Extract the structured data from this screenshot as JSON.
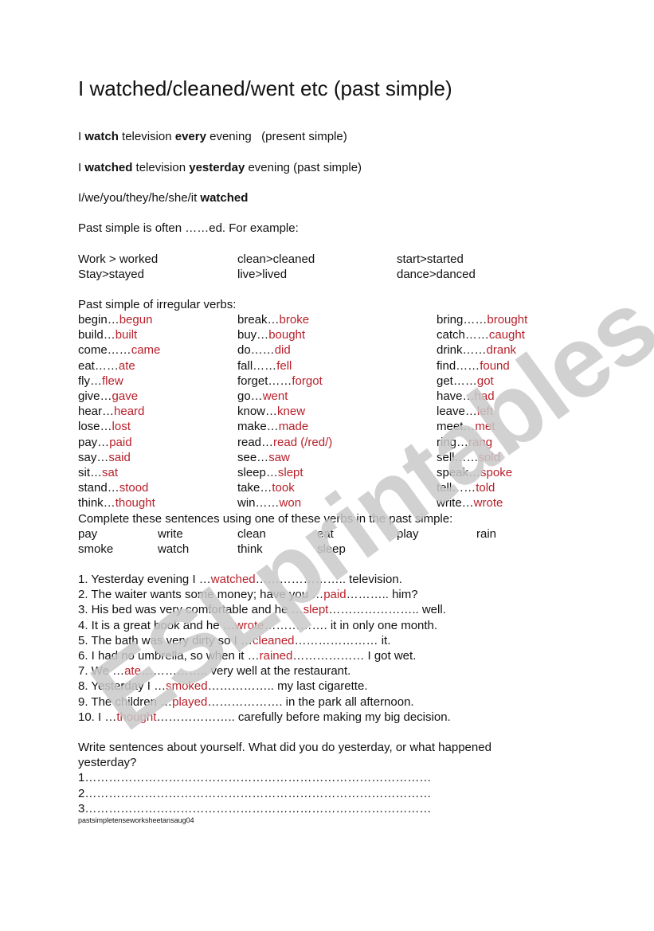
{
  "title": "I watched/cleaned/went etc (past simple)",
  "intro": {
    "line1": {
      "p1": "I ",
      "b1": "watch",
      "p2": " television ",
      "b2": "every",
      "p3": " evening   (present simple)"
    },
    "line2": {
      "p1": "I ",
      "b1": "watched",
      "p2": " television ",
      "b2": "yesterday",
      "p3": " evening (past simple)"
    },
    "line3": {
      "p1": "I/we/you/they/he/she/it ",
      "b1": "watched"
    },
    "line4": "Past simple is often ……ed. For example:"
  },
  "regular_examples": [
    [
      "Work > worked",
      "clean>cleaned",
      "start>started"
    ],
    [
      "Stay>stayed",
      "live>lived",
      "dance>danced"
    ]
  ],
  "irregular_heading": "Past simple of irregular verbs:",
  "irregular_verbs": [
    [
      {
        "base": "begin…",
        "past": "begun"
      },
      {
        "base": "break…",
        "past": "broke"
      },
      {
        "base": "bring……",
        "past": "brought"
      }
    ],
    [
      {
        "base": "build…",
        "past": "built"
      },
      {
        "base": "buy…",
        "past": "bought"
      },
      {
        "base": "catch……",
        "past": "caught"
      }
    ],
    [
      {
        "base": "come……",
        "past": "came"
      },
      {
        "base": "do……",
        "past": "did"
      },
      {
        "base": "drink……",
        "past": "drank"
      }
    ],
    [
      {
        "base": "eat……",
        "past": "ate"
      },
      {
        "base": "fall……",
        "past": "fell"
      },
      {
        "base": "find……",
        "past": "found"
      }
    ],
    [
      {
        "base": "fly…",
        "past": "flew"
      },
      {
        "base": "forget……",
        "past": "forgot"
      },
      {
        "base": "get……",
        "past": "got"
      }
    ],
    [
      {
        "base": "give…",
        "past": "gave"
      },
      {
        "base": "go…",
        "past": "went"
      },
      {
        "base": "have…",
        "past": "had"
      }
    ],
    [
      {
        "base": "hear…",
        "past": "heard"
      },
      {
        "base": "know…",
        "past": "knew"
      },
      {
        "base": "leave…",
        "past": "left"
      }
    ],
    [
      {
        "base": "lose…",
        "past": "lost"
      },
      {
        "base": "make…",
        "past": "made"
      },
      {
        "base": "meet…",
        "past": "met"
      }
    ],
    [
      {
        "base": "pay…",
        "past": "paid"
      },
      {
        "base": "read…",
        "past": "read (/red/)"
      },
      {
        "base": "ring…",
        "past": "rang"
      }
    ],
    [
      {
        "base": "say…",
        "past": "said"
      },
      {
        "base": "see…",
        "past": "saw"
      },
      {
        "base": "sell……",
        "past": "sold"
      }
    ],
    [
      {
        "base": "sit…",
        "past": "sat"
      },
      {
        "base": "sleep…",
        "past": "slept"
      },
      {
        "base": "speak…",
        "past": "spoke"
      }
    ],
    [
      {
        "base": "stand…",
        "past": "stood"
      },
      {
        "base": "take…",
        "past": "took"
      },
      {
        "base": "tell……",
        "past": "told"
      }
    ],
    [
      {
        "base": "think…",
        "past": "thought"
      },
      {
        "base": "win……",
        "past": "won"
      },
      {
        "base": "write…",
        "past": "wrote"
      }
    ]
  ],
  "exercise1": {
    "instruction": "Complete these sentences using one of these verbs in the past simple:",
    "verbs_row1": [
      "pay",
      "write",
      "clean",
      "eat",
      "play",
      "rain"
    ],
    "verbs_row2": [
      "smoke",
      "watch",
      "think",
      "sleep"
    ],
    "sentences": [
      {
        "pre": "1. Yesterday evening I …",
        "answer": "watched",
        "post": "………………….. television."
      },
      {
        "pre": "2. The waiter wants some money; have you …",
        "answer": "paid",
        "post": "………..  him?"
      },
      {
        "pre": "3. His bed was very comfortable and he …",
        "answer": "slept",
        "post": "………………….. well."
      },
      {
        "pre": "4. It is a great book and he …",
        "answer": "wrote",
        "post": "……………. it in only one month."
      },
      {
        "pre": "5. The bath was very dirty so I …",
        "answer": "cleaned",
        "post": "………………… it."
      },
      {
        "pre": "6. I had no umbrella, so when it …",
        "answer": "rained",
        "post": "……………… I got wet."
      },
      {
        "pre": "7. We …",
        "answer": "ate",
        "post": "……………..  very well at the restaurant."
      },
      {
        "pre": "8. Yesterday I …",
        "answer": "smoked",
        "post": "…………….. my last cigarette."
      },
      {
        "pre": "9. The children …",
        "answer": "played",
        "post": "………………. in the park all afternoon."
      },
      {
        "pre": "10. I …",
        "answer": "thought",
        "post": "……………….. carefully before making my big decision."
      }
    ]
  },
  "exercise2": {
    "instruction_line1": "Write sentences about yourself. What did you do yesterday, or what happened",
    "instruction_line2": "yesterday?",
    "lines": [
      "1……………………………………………………………………………",
      "2……………………………………………………………………………",
      "3……………………………………………………………………………"
    ]
  },
  "footer": "pastsimpletenseworksheetansaug04",
  "watermark": "ESLprintables.com",
  "colors": {
    "answer": "#b8202a",
    "watermark": "#c9c9c9",
    "text": "#111111"
  }
}
